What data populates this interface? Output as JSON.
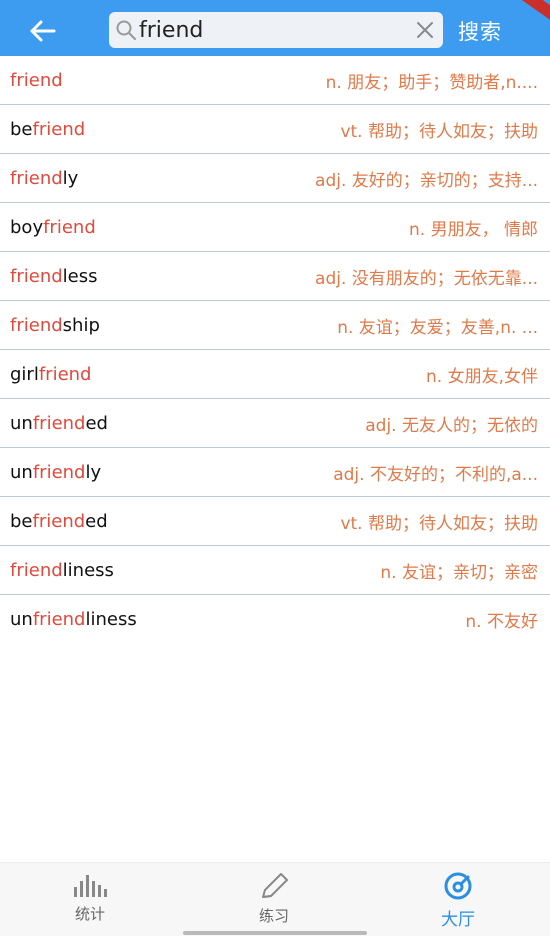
{
  "search": {
    "value": "friend",
    "button_label": "搜索"
  },
  "results": [
    {
      "pre": "",
      "hl": "friend",
      "post": "",
      "meaning": "n. 朋友；助手；赞助者,n...."
    },
    {
      "pre": "be",
      "hl": "friend",
      "post": "",
      "meaning": "vt. 帮助；待人如友；扶助"
    },
    {
      "pre": "",
      "hl": "friend",
      "post": "ly",
      "meaning": "adj. 友好的；亲切的；支持..."
    },
    {
      "pre": "boy",
      "hl": "friend",
      "post": "",
      "meaning": "n. 男朋友， 情郎"
    },
    {
      "pre": "",
      "hl": "friend",
      "post": "less",
      "meaning": "adj. 没有朋友的；无依无靠..."
    },
    {
      "pre": "",
      "hl": "friend",
      "post": "ship",
      "meaning": "n. 友谊；友爱；友善,n. ..."
    },
    {
      "pre": "girl",
      "hl": "friend",
      "post": "",
      "meaning": "n. 女朋友,女伴"
    },
    {
      "pre": "un",
      "hl": "friend",
      "post": "ed",
      "meaning": "adj. 无友人的；无依的"
    },
    {
      "pre": "un",
      "hl": "friend",
      "post": "ly",
      "meaning": "adj. 不友好的；不利的,a..."
    },
    {
      "pre": "be",
      "hl": "friend",
      "post": "ed",
      "meaning": "vt. 帮助；待人如友；扶助"
    },
    {
      "pre": "",
      "hl": "friend",
      "post": "liness",
      "meaning": "n. 友谊；亲切；亲密"
    },
    {
      "pre": "un",
      "hl": "friend",
      "post": "liness",
      "meaning": "n. 不友好"
    }
  ],
  "nav": {
    "stats": "统计",
    "practice": "练习",
    "hall": "大厅"
  },
  "colors": {
    "app_bar": "#3d9cf0",
    "highlight": "#e0493c",
    "meaning": "#e07a4a",
    "active_nav": "#2a8fe0"
  }
}
